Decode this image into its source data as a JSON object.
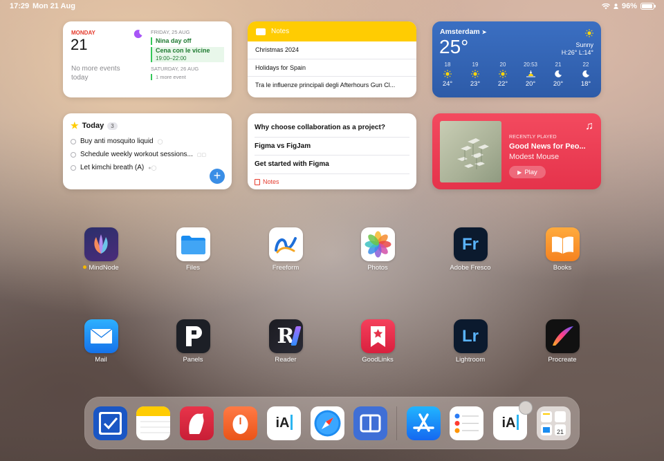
{
  "status": {
    "time": "17:29",
    "date": "Mon 21 Aug",
    "battery": "96%",
    "battery_level": 0.96
  },
  "calendar": {
    "day_name": "MONDAY",
    "day_num": "21",
    "no_more": "No more events today",
    "d1_head": "FRIDAY, 25 AUG",
    "ev1": "Nina day off",
    "ev2": "Cena con le vicine",
    "ev2_time": "19:00–22:00",
    "d2_head": "SATURDAY, 26 AUG",
    "more": "1 more event"
  },
  "notes_widget": {
    "title": "Notes",
    "rows": [
      "Christmas 2024",
      "Holidays for Spain",
      "Tra le influenze principali degli Afterhours Gun Cl..."
    ]
  },
  "weather": {
    "city": "Amsterdam",
    "temp": "25°",
    "condition": "Sunny",
    "hilo": "H:26° L:14°",
    "forecast": [
      {
        "hour": "18",
        "icon": "sun-icon",
        "temp": "24°"
      },
      {
        "hour": "19",
        "icon": "sun-icon",
        "temp": "23°"
      },
      {
        "hour": "20",
        "icon": "sun-icon",
        "temp": "22°"
      },
      {
        "hour": "20:53",
        "icon": "sunset-icon",
        "temp": "20°"
      },
      {
        "hour": "21",
        "icon": "moon-icon",
        "temp": "20°"
      },
      {
        "hour": "22",
        "icon": "moon-icon",
        "temp": "18°"
      }
    ]
  },
  "reminders": {
    "title": "Today",
    "count": "3",
    "items": [
      "Buy anti mosquito liquid",
      "Schedule weekly workout sessions...",
      "Let kimchi breath (A)"
    ]
  },
  "notes_list": {
    "items": [
      "Why choose collaboration as a project?",
      "Figma vs FigJam",
      "Get started with Figma"
    ],
    "footer": "Notes"
  },
  "music": {
    "label": "RECENTLY PLAYED",
    "song": "Good News for Peo...",
    "artist": "Modest Mouse",
    "play": "Play"
  },
  "apps": [
    {
      "name": "MindNode",
      "label": "MindNode"
    },
    {
      "name": "Files",
      "label": "Files"
    },
    {
      "name": "Freeform",
      "label": "Freeform"
    },
    {
      "name": "Photos",
      "label": "Photos"
    },
    {
      "name": "Adobe Fresco",
      "label": "Adobe Fresco"
    },
    {
      "name": "Books",
      "label": "Books"
    },
    {
      "name": "Mail",
      "label": "Mail"
    },
    {
      "name": "Panels",
      "label": "Panels"
    },
    {
      "name": "Reader",
      "label": "Reader"
    },
    {
      "name": "GoodLinks",
      "label": "GoodLinks"
    },
    {
      "name": "Lightroom",
      "label": "Lightroom"
    },
    {
      "name": "Procreate",
      "label": "Procreate"
    }
  ],
  "icon_text": {
    "fresco": "Fr",
    "lightroom": "Lr",
    "ia": "iA",
    "reader": "R",
    "cal_date": "21"
  }
}
